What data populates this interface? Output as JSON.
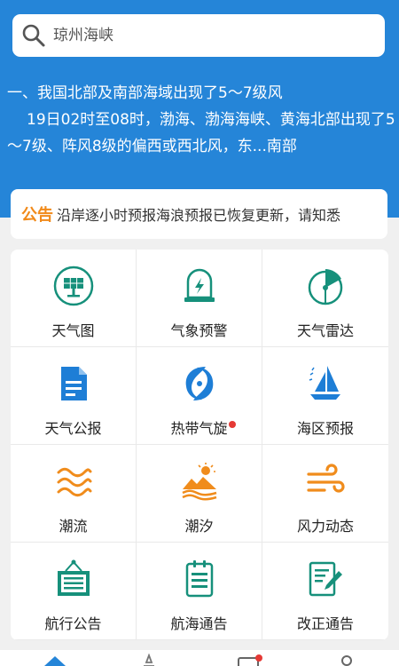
{
  "search": {
    "placeholder": "琼州海峡",
    "icon": "search-icon"
  },
  "news": {
    "title": "一、我国北部及南部海域出现了5～7级风",
    "body": "19日02时至08时，渤海、渤海海峡、黄海北部出现了5～7级、阵风8级的偏西或西北风，东...南部"
  },
  "notice": {
    "label": "公告",
    "text": "沿岸逐小时预报海浪预报已恢复更新，请知悉"
  },
  "colors": {
    "primary": "#2585d8",
    "teal": "#16907b",
    "blue": "#1e7ed6",
    "orange": "#f08c1c",
    "notice": "#f18a1a",
    "badge": "#e53935"
  },
  "grid": [
    {
      "label": "天气图",
      "icon": "solar-panel-icon"
    },
    {
      "label": "气象预警",
      "icon": "warning-lightning-icon"
    },
    {
      "label": "天气雷达",
      "icon": "radar-icon"
    },
    {
      "label": "天气公报",
      "icon": "document-icon"
    },
    {
      "label": "热带气旋",
      "icon": "cyclone-icon",
      "badge": true
    },
    {
      "label": "海区预报",
      "icon": "sailboat-icon"
    },
    {
      "label": "潮流",
      "icon": "waves-icon"
    },
    {
      "label": "潮汐",
      "icon": "tide-sun-icon"
    },
    {
      "label": "风力动态",
      "icon": "wind-icon"
    },
    {
      "label": "航行公告",
      "icon": "notice-board-icon"
    },
    {
      "label": "航海通告",
      "icon": "clipboard-icon"
    },
    {
      "label": "改正通告",
      "icon": "edit-document-icon"
    }
  ],
  "bottom_nav": [
    {
      "icon": "home-icon"
    },
    {
      "icon": "star-icon"
    },
    {
      "icon": "message-icon",
      "badge": true
    },
    {
      "icon": "user-icon"
    }
  ]
}
